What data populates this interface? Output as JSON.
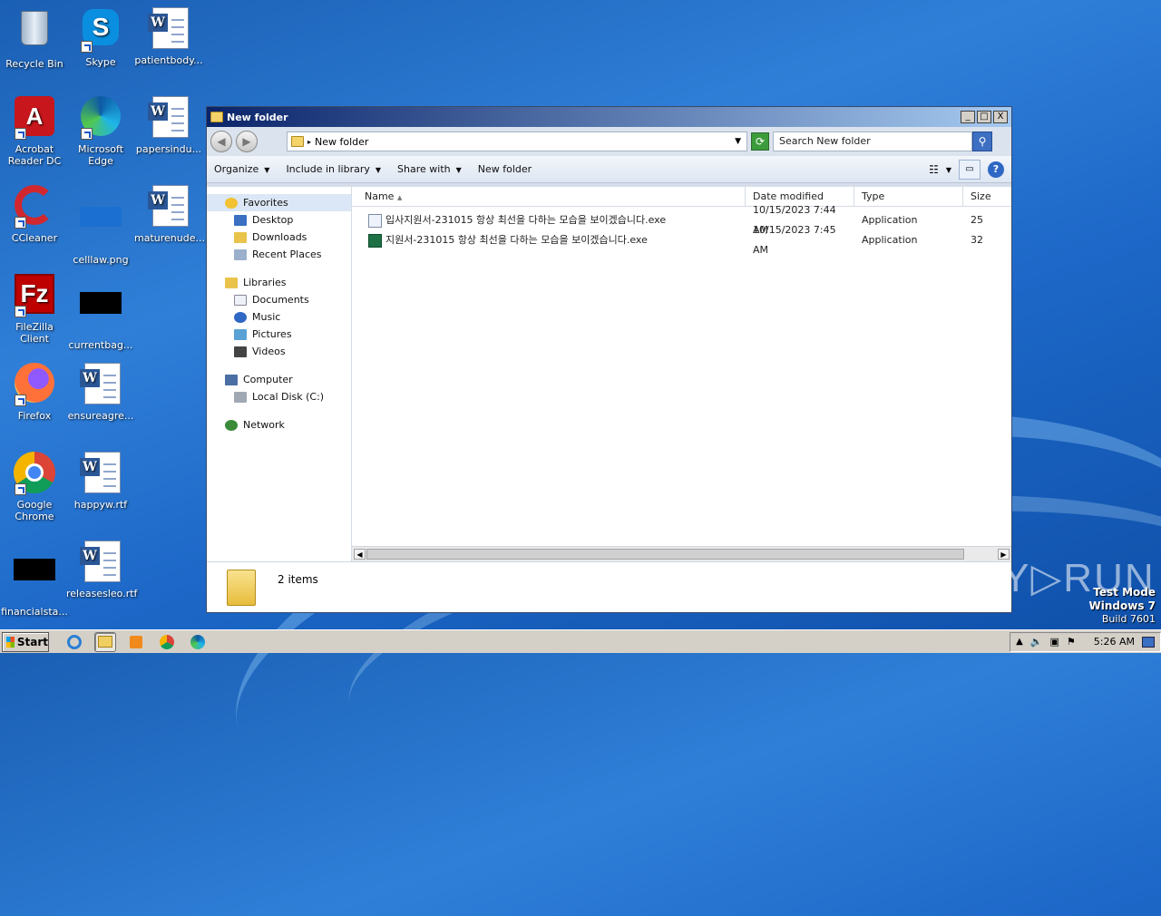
{
  "desktop": {
    "icons": [
      {
        "label": "Recycle Bin"
      },
      {
        "label": "Skype"
      },
      {
        "label": "patientbody..."
      },
      {
        "label": "Acrobat Reader DC"
      },
      {
        "label": "Microsoft Edge"
      },
      {
        "label": "papersindu..."
      },
      {
        "label": "CCleaner"
      },
      {
        "label": "celllaw.png"
      },
      {
        "label": "maturenude..."
      },
      {
        "label": "FileZilla Client"
      },
      {
        "label": "currentbag..."
      },
      {
        "label": "Firefox"
      },
      {
        "label": "ensureagre..."
      },
      {
        "label": "Google Chrome"
      },
      {
        "label": "happyw.rtf"
      },
      {
        "label": "financialsta..."
      },
      {
        "label": "releasesleo.rtf"
      }
    ]
  },
  "window": {
    "title": "New folder",
    "controls": {
      "minimize": "_",
      "maximize": "□",
      "close": "X"
    },
    "address": {
      "crumb": "New folder",
      "search_placeholder": "Search New folder"
    },
    "commands": [
      "Organize",
      "Include in library",
      "Share with",
      "New folder"
    ],
    "nav": {
      "favorites": {
        "label": "Favorites",
        "items": [
          "Desktop",
          "Downloads",
          "Recent Places"
        ]
      },
      "libraries": {
        "label": "Libraries",
        "items": [
          "Documents",
          "Music",
          "Pictures",
          "Videos"
        ]
      },
      "computer": {
        "label": "Computer",
        "items": [
          "Local Disk (C:)"
        ]
      },
      "network": {
        "label": "Network"
      }
    },
    "columns": {
      "name": "Name",
      "date": "Date modified",
      "type": "Type",
      "size": "Size"
    },
    "files": [
      {
        "name": "입사지원서-231015 항상 최선을 다하는 모습을 보이겠습니다.exe",
        "date": "10/15/2023 7:44 AM",
        "type": "Application",
        "size": "25"
      },
      {
        "name": "지원서-231015 항상 최선을 다하는 모습을 보이겠습니다.exe",
        "date": "10/15/2023 7:45 AM",
        "type": "Application",
        "size": "32"
      }
    ],
    "status": "2 items"
  },
  "taskbar": {
    "start": "Start",
    "clock": "5:26 AM"
  },
  "watermark": {
    "line1": "Test Mode",
    "line2": "Windows 7",
    "line3": "Build 7601",
    "brand": "ANY RUN"
  }
}
